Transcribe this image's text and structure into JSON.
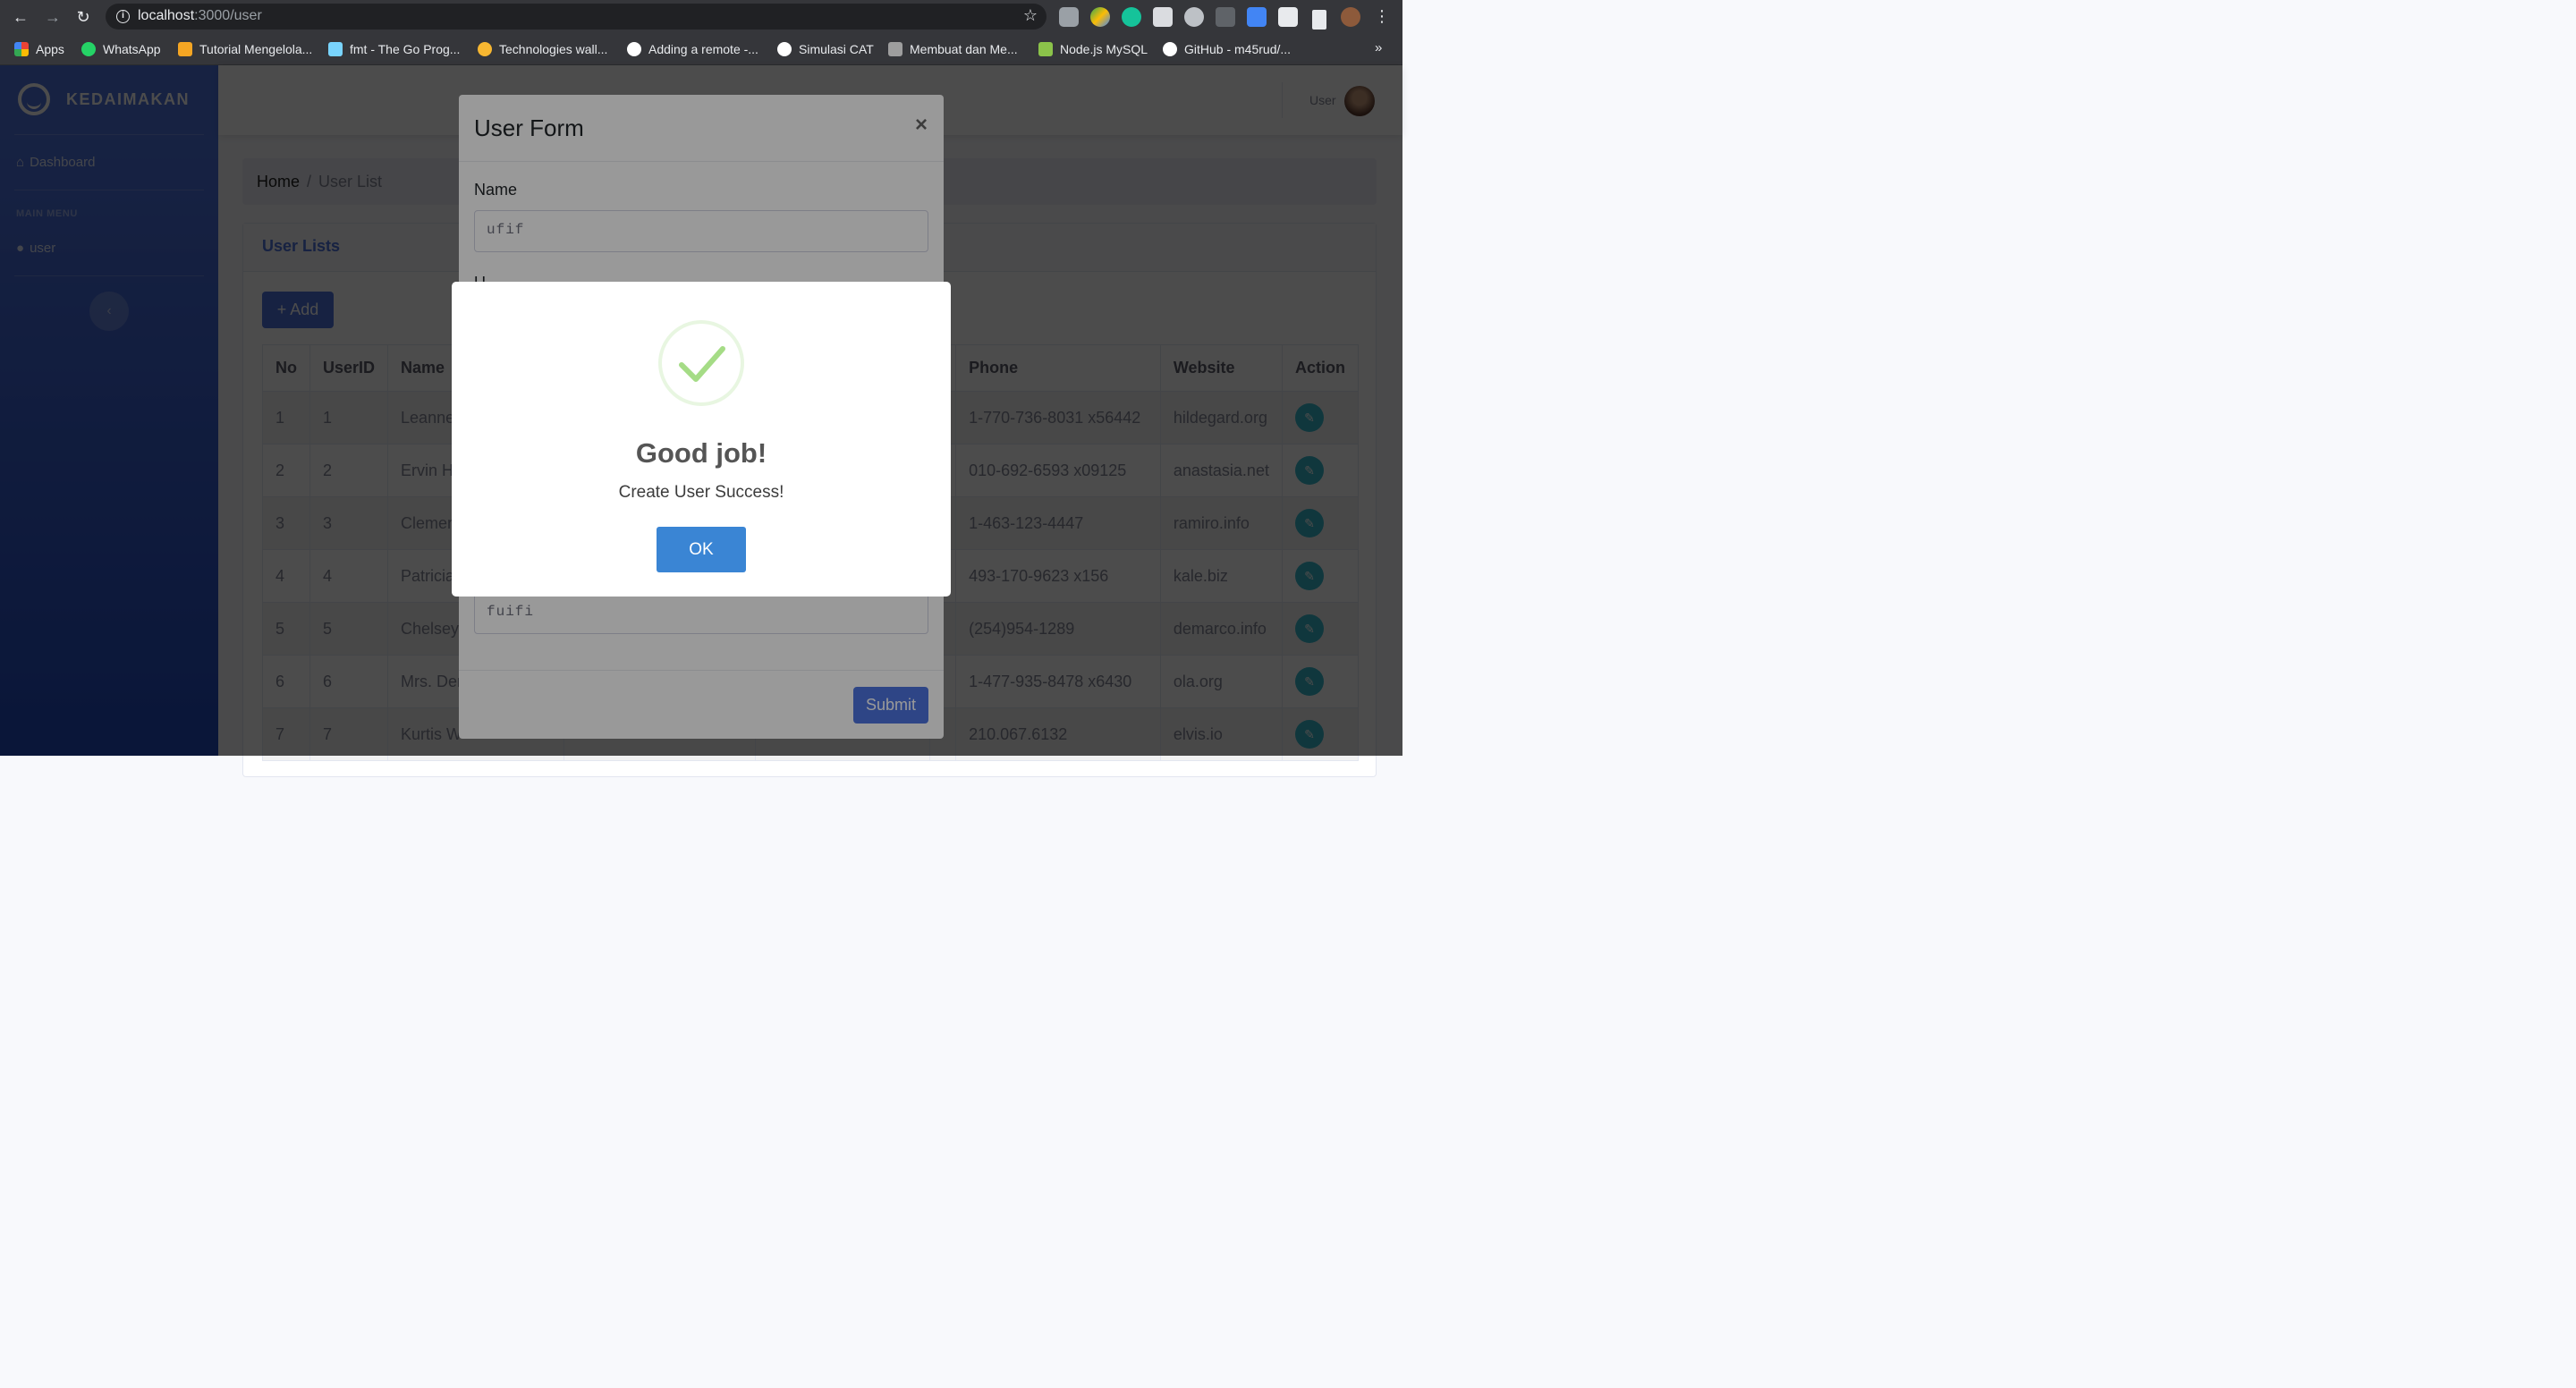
{
  "browser": {
    "url_host": "localhost",
    "url_path": ":3000/user",
    "bookmarks": [
      {
        "label": "Apps",
        "color": "#ea4335"
      },
      {
        "label": "WhatsApp",
        "color": "#25d366"
      },
      {
        "label": "Tutorial Mengelola...",
        "color": "#f5a623"
      },
      {
        "label": "fmt - The Go Prog...",
        "color": "#79d4fd"
      },
      {
        "label": "Technologies wall...",
        "color": "#f7b731"
      },
      {
        "label": "Adding a remote -...",
        "color": "#ffffff"
      },
      {
        "label": "Simulasi CAT",
        "color": "#ffffff"
      },
      {
        "label": "Membuat dan Me...",
        "color": "#9e9e9e"
      },
      {
        "label": "Node.js MySQL",
        "color": "#8bc34a"
      },
      {
        "label": "GitHub - m45rud/...",
        "color": "#ffffff"
      }
    ],
    "more": "»"
  },
  "sidebar": {
    "brand": "KEDAIMAKAN",
    "dashboard": "Dashboard",
    "heading": "MAIN MENU",
    "user_item": "user",
    "toggle": "‹"
  },
  "topbar": {
    "user_name": "User"
  },
  "breadcrumb": {
    "home": "Home",
    "separator": "/",
    "current": "User List"
  },
  "card": {
    "title": "User Lists",
    "add_label": "Add"
  },
  "table": {
    "headers": [
      "No",
      "UserID",
      "Name",
      "",
      "",
      "",
      "Phone",
      "Website",
      "Action"
    ],
    "rows": [
      {
        "no": "1",
        "id": "1",
        "name": "Leanne",
        "phone": "1-770-736-8031 x56442",
        "website": "hildegard.org"
      },
      {
        "no": "2",
        "id": "2",
        "name": "Ervin Ho",
        "phone": "010-692-6593 x09125",
        "website": "anastasia.net"
      },
      {
        "no": "3",
        "id": "3",
        "name": "Clemen",
        "phone": "1-463-123-4447",
        "website": "ramiro.info"
      },
      {
        "no": "4",
        "id": "4",
        "name": "Patricia",
        "phone": "493-170-9623 x156",
        "website": "kale.biz"
      },
      {
        "no": "5",
        "id": "5",
        "name": "Chelsey",
        "phone": "(254)954-1289",
        "website": "demarco.info"
      },
      {
        "no": "6",
        "id": "6",
        "name": "Mrs. Den",
        "phone": "1-477-935-8478 x6430",
        "website": "ola.org"
      },
      {
        "no": "7",
        "id": "7",
        "name": "Kurtis W",
        "phone": "210.067.6132",
        "website": "elvis.io"
      }
    ]
  },
  "modal": {
    "title": "User Form",
    "close": "×",
    "name_label": "Name",
    "name_value": "ufif",
    "second_label_partial": "U",
    "last_value": "fuifi",
    "submit_label": "Submit"
  },
  "alert": {
    "title": "Good job!",
    "text": "Create User Success!",
    "ok_label": "OK",
    "icon": "success-check-icon",
    "check_color": "#a5dc86",
    "button_color": "#3a85d4"
  }
}
